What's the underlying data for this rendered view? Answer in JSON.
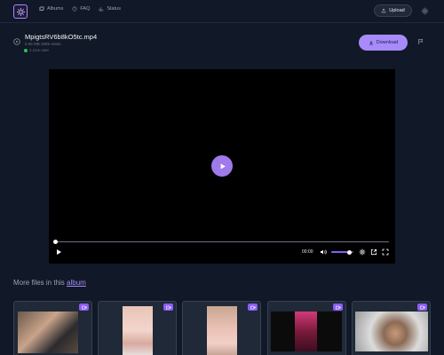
{
  "header": {
    "nav": [
      {
        "label": "Albums",
        "icon": "albums-icon"
      },
      {
        "label": "FAQ",
        "icon": "help-circle-icon"
      },
      {
        "label": "Status",
        "icon": "status-chart-icon"
      }
    ],
    "upload_label": "Upload"
  },
  "file": {
    "name": "MpigtsRV6b8kO5tc.mp4",
    "meta": "6.65 MB 2995 views",
    "live": "1 Live user",
    "download_label": "Download"
  },
  "player": {
    "time": "00:00",
    "volume": 0.8,
    "progress": 0
  },
  "more": {
    "prefix": "More files in this",
    "link": "album"
  },
  "colors": {
    "accent": "#a78bfa",
    "background": "#111827",
    "live": "#22c55e"
  }
}
